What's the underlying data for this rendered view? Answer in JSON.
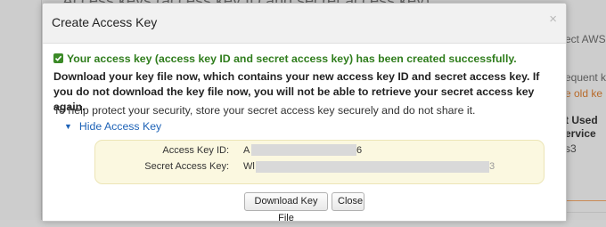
{
  "background": {
    "title": "Access keys (access key ID and secret access key)",
    "right_fragments": [
      "ect AWS",
      "equent k",
      "e old ke",
      "t Used",
      "ervice",
      "s3"
    ]
  },
  "modal": {
    "title": "Create Access Key",
    "close_glyph": "×",
    "success_message": "Your access key (access key ID and secret access key) has been created successfully.",
    "warning": "Download your key file now, which contains your new access key ID and secret access key. If you do not download the key file now, you will not be able to retrieve your secret access key again.",
    "protect_note": "To help protect your security, store your secret access key securely and do not share it.",
    "toggle_label": "Hide Access Key",
    "access_key_id_label": "Access Key ID:",
    "access_key_id_prefix": "A",
    "access_key_id_suffix": "6",
    "secret_key_label": "Secret Access Key:",
    "secret_key_prefix": "Wl",
    "secret_key_suffix": "3",
    "download_button": "Download Key File",
    "close_button": "Close"
  },
  "colors": {
    "success": "#2f7d1c",
    "link": "#1d62b6",
    "key_box_bg": "#fbf8e0"
  },
  "icons": [
    "check-icon",
    "close-icon",
    "triangle-down-icon"
  ]
}
